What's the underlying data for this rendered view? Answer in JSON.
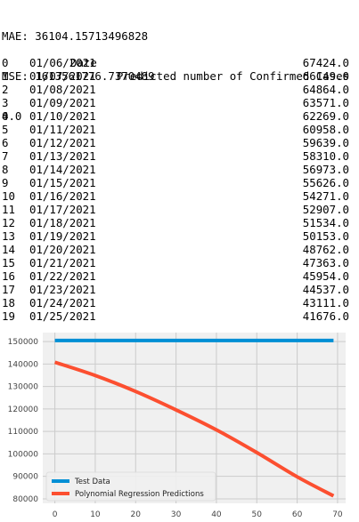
{
  "output": {
    "mae_line": "MAE: 36104.15713496828",
    "mse_line": "MSE: 1613561776.7370489",
    "score_line": "0.0"
  },
  "table": {
    "columns": [
      "Date",
      "Predicted number of Confirmed Cases"
    ],
    "rows": [
      {
        "idx": "0",
        "date": "01/06/2021",
        "value": "67424.0"
      },
      {
        "idx": "1",
        "date": "01/07/2021",
        "value": "66149.0"
      },
      {
        "idx": "2",
        "date": "01/08/2021",
        "value": "64864.0"
      },
      {
        "idx": "3",
        "date": "01/09/2021",
        "value": "63571.0"
      },
      {
        "idx": "4",
        "date": "01/10/2021",
        "value": "62269.0"
      },
      {
        "idx": "5",
        "date": "01/11/2021",
        "value": "60958.0"
      },
      {
        "idx": "6",
        "date": "01/12/2021",
        "value": "59639.0"
      },
      {
        "idx": "7",
        "date": "01/13/2021",
        "value": "58310.0"
      },
      {
        "idx": "8",
        "date": "01/14/2021",
        "value": "56973.0"
      },
      {
        "idx": "9",
        "date": "01/15/2021",
        "value": "55626.0"
      },
      {
        "idx": "10",
        "date": "01/16/2021",
        "value": "54271.0"
      },
      {
        "idx": "11",
        "date": "01/17/2021",
        "value": "52907.0"
      },
      {
        "idx": "12",
        "date": "01/18/2021",
        "value": "51534.0"
      },
      {
        "idx": "13",
        "date": "01/19/2021",
        "value": "50153.0"
      },
      {
        "idx": "14",
        "date": "01/20/2021",
        "value": "48762.0"
      },
      {
        "idx": "15",
        "date": "01/21/2021",
        "value": "47363.0"
      },
      {
        "idx": "16",
        "date": "01/22/2021",
        "value": "45954.0"
      },
      {
        "idx": "17",
        "date": "01/23/2021",
        "value": "44537.0"
      },
      {
        "idx": "18",
        "date": "01/24/2021",
        "value": "43111.0"
      },
      {
        "idx": "19",
        "date": "01/25/2021",
        "value": "41676.0"
      }
    ]
  },
  "chart_data": {
    "type": "line",
    "xlim": [
      -3,
      72
    ],
    "ylim": [
      78000,
      154000
    ],
    "xticks": [
      0,
      10,
      20,
      30,
      40,
      50,
      60,
      70
    ],
    "yticks": [
      80000,
      90000,
      100000,
      110000,
      120000,
      130000,
      140000,
      150000
    ],
    "grid": true,
    "legend_position": "lower-left",
    "series": [
      {
        "name": "Test Data",
        "color": "#008fd5",
        "x": [
          0,
          69
        ],
        "y": [
          150500,
          150500
        ]
      },
      {
        "name": "Polynomial Regression Predictions",
        "color": "#fc4f30",
        "x": [
          0,
          10,
          20,
          30,
          40,
          50,
          60,
          69
        ],
        "y": [
          140800,
          134900,
          127800,
          119600,
          110700,
          100600,
          89800,
          81300
        ]
      }
    ]
  }
}
